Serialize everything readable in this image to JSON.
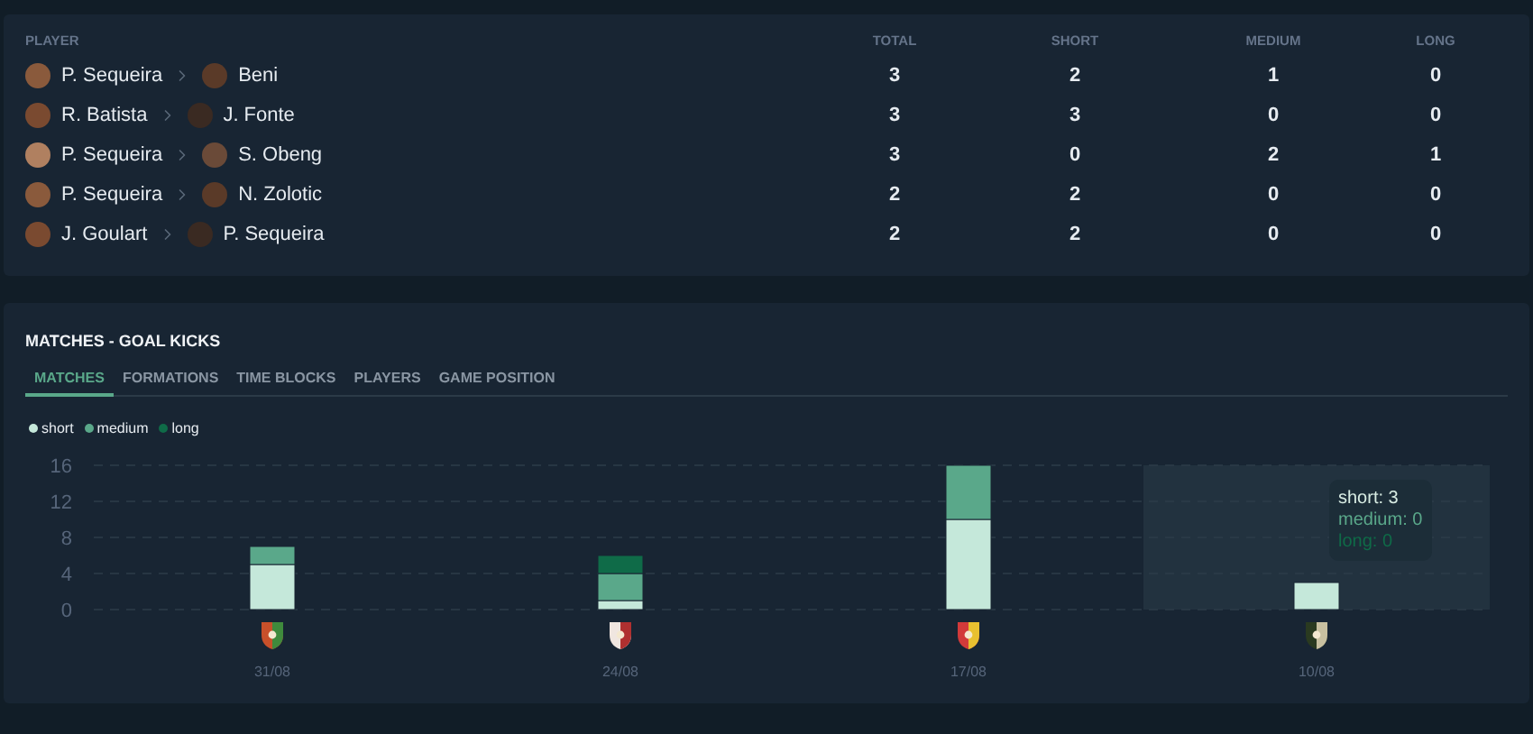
{
  "passes_table": {
    "columns": [
      "PLAYER",
      "TOTAL",
      "SHORT",
      "MEDIUM",
      "LONG"
    ],
    "rows": [
      {
        "from": "P. Sequeira",
        "to": "Beni",
        "total": "3",
        "short": "2",
        "medium": "1",
        "long": "0"
      },
      {
        "from": "R. Batista",
        "to": "J. Fonte",
        "total": "3",
        "short": "3",
        "medium": "0",
        "long": "0"
      },
      {
        "from": "P. Sequeira",
        "to": "S. Obeng",
        "total": "3",
        "short": "0",
        "medium": "2",
        "long": "1"
      },
      {
        "from": "P. Sequeira",
        "to": "N. Zolotic",
        "total": "2",
        "short": "2",
        "medium": "0",
        "long": "0"
      },
      {
        "from": "J. Goulart",
        "to": "P. Sequeira",
        "total": "2",
        "short": "2",
        "medium": "0",
        "long": "0"
      }
    ]
  },
  "goal_kicks": {
    "title": "MATCHES - GOAL KICKS",
    "tabs": [
      {
        "label": "MATCHES",
        "selected": true
      },
      {
        "label": "FORMATIONS",
        "selected": false
      },
      {
        "label": "TIME BLOCKS",
        "selected": false
      },
      {
        "label": "PLAYERS",
        "selected": false
      },
      {
        "label": "GAME POSITION",
        "selected": false
      }
    ],
    "chart_data": {
      "type": "bar",
      "stacked": true,
      "grid": true,
      "categories": [
        "31/08",
        "24/08",
        "17/08",
        "10/08"
      ],
      "series": [
        {
          "name": "short",
          "color": "#c5e8da",
          "values": [
            5,
            1,
            10,
            3
          ]
        },
        {
          "name": "medium",
          "color": "#5aa88a",
          "values": [
            2,
            3,
            6,
            0
          ]
        },
        {
          "name": "long",
          "color": "#0f6b48",
          "values": [
            0,
            2,
            0,
            0
          ]
        }
      ],
      "ylim": [
        0,
        16
      ],
      "yticks": [
        0,
        4,
        8,
        12,
        16
      ]
    },
    "tooltip": {
      "lines": [
        "short: 3",
        "medium: 0",
        "long: 0"
      ]
    }
  }
}
